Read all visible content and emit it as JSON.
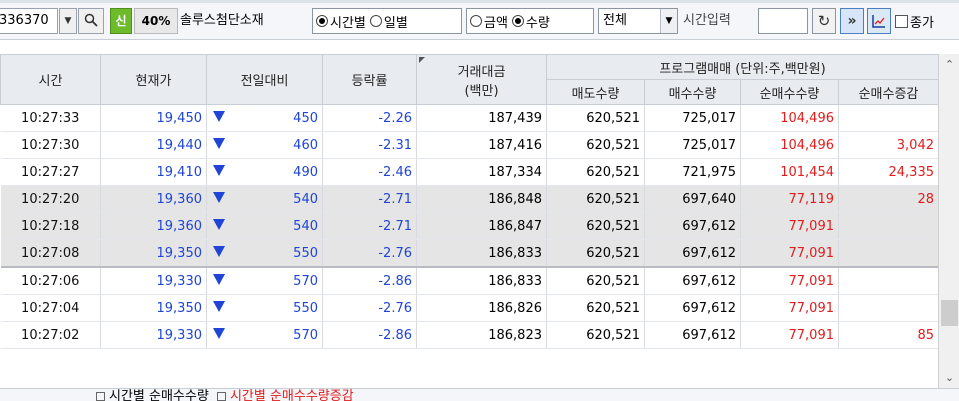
{
  "toolbar": {
    "stock_code": "336370",
    "badge_new": "신",
    "badge_ratio": "40%",
    "stock_name": "솔루스첨단소재",
    "view_options": [
      "시간별",
      "일별"
    ],
    "view_selected": 0,
    "unit_options": [
      "금액",
      "수량"
    ],
    "unit_selected": 1,
    "filter_value": "전체",
    "time_label": "시간입력",
    "time_value": "",
    "checkbox_label": "종가"
  },
  "table": {
    "headers": {
      "time": "시간",
      "price": "현재가",
      "change": "전일대비",
      "rate": "등락률",
      "volume_line1": "거래대금",
      "volume_line2": "(백만)",
      "program_group": "프로그램매매  (단위:주,백만원)",
      "sell_qty": "매도수량",
      "buy_qty": "매수수량",
      "net_qty": "순매수수량",
      "net_delta": "순매수증감"
    },
    "rows": [
      {
        "time": "10:27:33",
        "price": "19,450",
        "change": "450",
        "rate": "-2.26",
        "volume": "187,439",
        "sell": "620,521",
        "buy": "725,017",
        "net": "104,496",
        "delta": ""
      },
      {
        "time": "10:27:30",
        "price": "19,440",
        "change": "460",
        "rate": "-2.31",
        "volume": "187,416",
        "sell": "620,521",
        "buy": "725,017",
        "net": "104,496",
        "delta": "3,042"
      },
      {
        "time": "10:27:27",
        "price": "19,410",
        "change": "490",
        "rate": "-2.46",
        "volume": "187,334",
        "sell": "620,521",
        "buy": "721,975",
        "net": "101,454",
        "delta": "24,335"
      },
      {
        "time": "10:27:20",
        "price": "19,360",
        "change": "540",
        "rate": "-2.71",
        "volume": "186,848",
        "sell": "620,521",
        "buy": "697,640",
        "net": "77,119",
        "delta": "28"
      },
      {
        "time": "10:27:18",
        "price": "19,360",
        "change": "540",
        "rate": "-2.71",
        "volume": "186,847",
        "sell": "620,521",
        "buy": "697,612",
        "net": "77,091",
        "delta": ""
      },
      {
        "time": "10:27:08",
        "price": "19,350",
        "change": "550",
        "rate": "-2.76",
        "volume": "186,833",
        "sell": "620,521",
        "buy": "697,612",
        "net": "77,091",
        "delta": ""
      },
      {
        "time": "10:27:06",
        "price": "19,330",
        "change": "570",
        "rate": "-2.86",
        "volume": "186,833",
        "sell": "620,521",
        "buy": "697,612",
        "net": "77,091",
        "delta": ""
      },
      {
        "time": "10:27:04",
        "price": "19,350",
        "change": "550",
        "rate": "-2.76",
        "volume": "186,826",
        "sell": "620,521",
        "buy": "697,612",
        "net": "77,091",
        "delta": ""
      },
      {
        "time": "10:27:02",
        "price": "19,330",
        "change": "570",
        "rate": "-2.86",
        "volume": "186,823",
        "sell": "620,521",
        "buy": "697,612",
        "net": "77,091",
        "delta": "85"
      }
    ]
  },
  "legend": {
    "item1": "시간별 순매수수량",
    "item2": "시간별 순매수수량증감"
  },
  "colors": {
    "down": "#1f44d6",
    "up": "#e21b1b",
    "badge_new": "#6dbb2b",
    "shade": "#e5e5e5"
  }
}
